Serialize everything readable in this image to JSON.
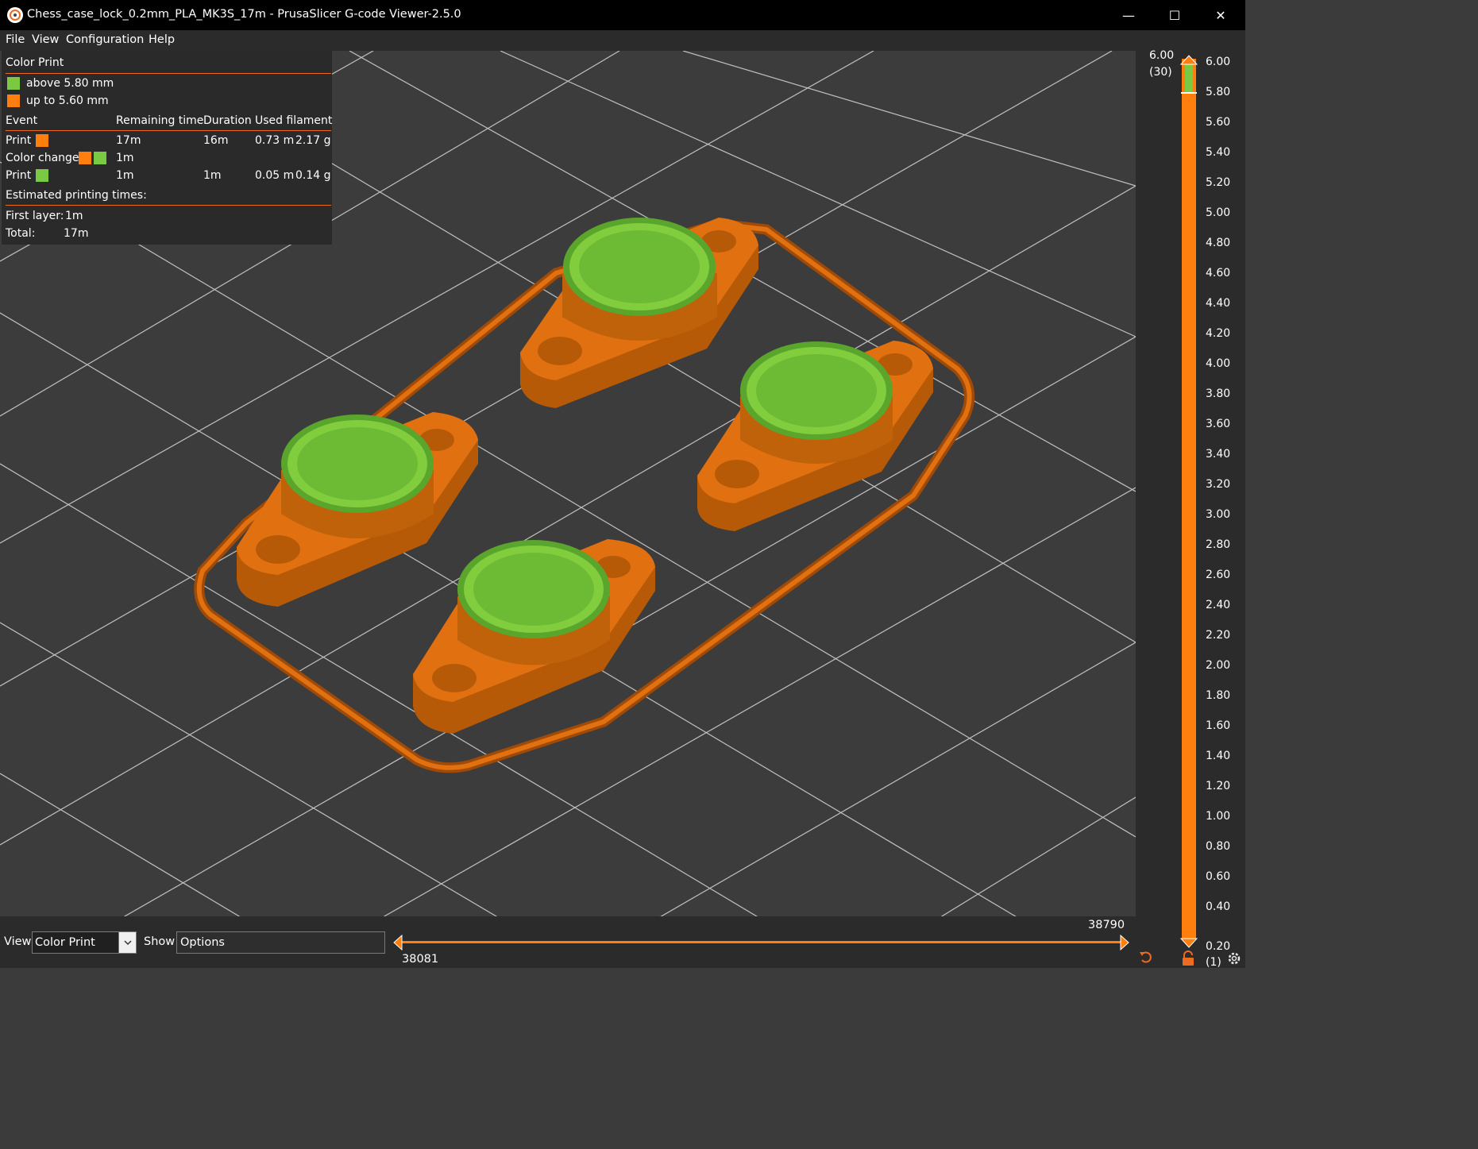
{
  "window": {
    "title": "Chess_case_lock_0.2mm_PLA_MK3S_17m - PrusaSlicer G-code Viewer-2.5.0",
    "minimize_glyph": "—",
    "maximize_glyph": "☐",
    "close_glyph": "✕"
  },
  "menu": {
    "items": [
      {
        "label": "File"
      },
      {
        "label": "View"
      },
      {
        "label": "Configuration"
      },
      {
        "label": "Help"
      }
    ]
  },
  "legend": {
    "title": "Color Print",
    "entries": [
      {
        "label": "above 5.80 mm",
        "color": "#7ac943"
      },
      {
        "label": "up to 5.60 mm",
        "color": "#ff7f0e"
      }
    ],
    "headers": {
      "event": "Event",
      "remaining": "Remaining time",
      "duration": "Duration",
      "filament": "Used filament"
    },
    "rows": [
      {
        "event": "Print",
        "remaining": "17m",
        "duration": "16m",
        "length": "0.73 m",
        "weight": "2.17 g"
      },
      {
        "event": "Color change",
        "remaining": "1m",
        "duration": "",
        "length": "",
        "weight": ""
      },
      {
        "event": "Print",
        "remaining": "1m",
        "duration": "1m",
        "length": "0.05 m",
        "weight": "0.14 g"
      }
    ],
    "estimated_title": "Estimated printing times:",
    "first_layer_label": "First layer:",
    "first_layer_value": "1m",
    "total_label": "Total:",
    "total_value": "17m"
  },
  "layer_slider": {
    "top_value": "6.00",
    "top_layer": "(30)",
    "bottom_value": "0.20",
    "bottom_layer": "(1)",
    "ticks": [
      "6.00",
      "5.80",
      "5.60",
      "5.40",
      "5.20",
      "5.00",
      "4.80",
      "4.60",
      "4.40",
      "4.20",
      "4.00",
      "3.80",
      "3.60",
      "3.40",
      "3.20",
      "3.00",
      "2.80",
      "2.60",
      "2.40",
      "2.20",
      "2.00",
      "1.80",
      "1.60",
      "1.40",
      "1.20",
      "1.00",
      "0.80",
      "0.60",
      "0.40",
      "0.20"
    ],
    "color_change_at": "5.80"
  },
  "bottom": {
    "view_label": "View",
    "view_value": "Color Print",
    "show_label": "Show",
    "show_value": "Options",
    "move_start": "38081",
    "move_end": "38790"
  },
  "colors": {
    "accent": "#ed6b21",
    "orange_filament": "#ff7f0e",
    "green_filament": "#7ac943",
    "background": "#3c3c3c",
    "panel": "#2b2b2b"
  },
  "icons": {
    "app": "prusaslicer-icon",
    "undo": "undo-icon",
    "lock": "lock-icon",
    "settings": "cog-icon"
  }
}
